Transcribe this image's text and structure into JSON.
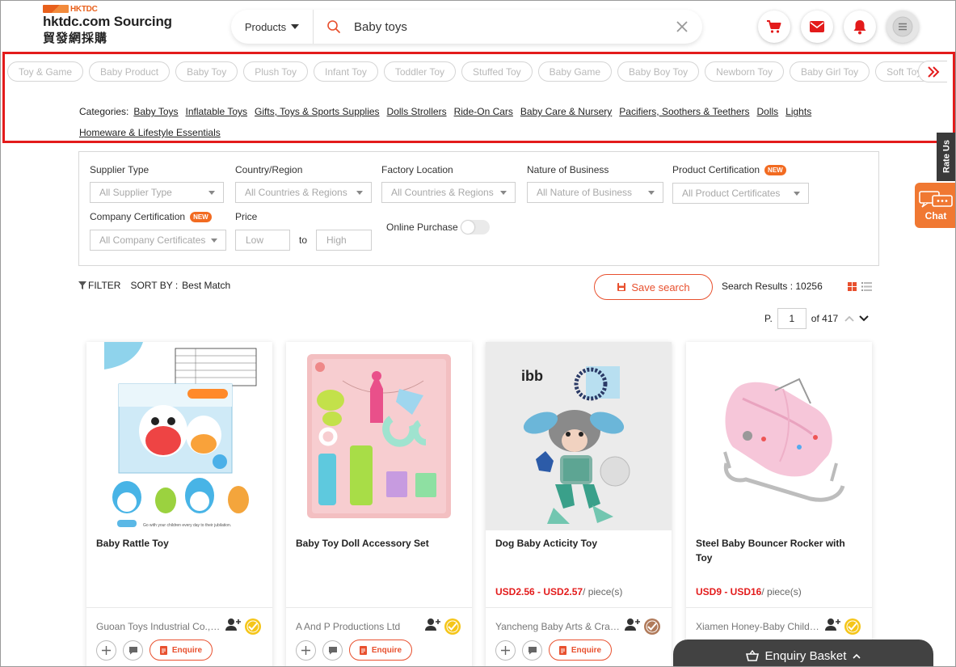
{
  "header": {
    "logo_brand": "HKTDC",
    "logo_title": "hktdc.com Sourcing",
    "logo_subtitle": "貿發網採購",
    "search_category": "Products",
    "search_query": "Baby toys"
  },
  "related_tags": [
    "Toy & Game",
    "Baby Product",
    "Baby Toy",
    "Plush Toy",
    "Infant Toy",
    "Toddler Toy",
    "Stuffed Toy",
    "Baby Game",
    "Baby Boy Toy",
    "Newborn Toy",
    "Baby Girl Toy",
    "Soft Toy"
  ],
  "categories": {
    "label": "Categories:",
    "items": [
      "Baby Toys",
      "Inflatable Toys",
      "Gifts, Toys & Sports Supplies",
      "Dolls Strollers",
      "Ride-On Cars",
      "Baby Care & Nursery",
      "Pacifiers, Soothers & Teethers",
      "Dolls",
      "Lights",
      "Homeware & Lifestyle Essentials"
    ]
  },
  "filters": {
    "supplier_type": {
      "label": "Supplier Type",
      "value": "All Supplier Type"
    },
    "country_region": {
      "label": "Country/Region",
      "value": "All Countries & Regions"
    },
    "factory_location": {
      "label": "Factory Location",
      "value": "All Countries & Regions"
    },
    "nature_of_business": {
      "label": "Nature of Business",
      "value": "All Nature of Business"
    },
    "product_certification": {
      "label": "Product Certification",
      "value": "All Product Certificates",
      "badge": "NEW"
    },
    "company_certification": {
      "label": "Company Certification",
      "value": "All Company Certificates",
      "badge": "NEW"
    },
    "price": {
      "label": "Price",
      "low_placeholder": "Low",
      "high_placeholder": "High",
      "to": "to"
    },
    "online_purchase": {
      "label": "Online Purchase",
      "enabled": false
    }
  },
  "sortbar": {
    "filter_label": "FILTER",
    "sort_label": "SORT BY :",
    "sort_value": "Best Match",
    "save_search": "Save search",
    "results": "Search Results : 10256"
  },
  "pager": {
    "prefix": "P.",
    "current": "1",
    "total": "of 417"
  },
  "products": [
    {
      "name": "Baby Rattle Toy",
      "price": "",
      "unit": "",
      "supplier": "Guoan Toys Industrial Co., Limited",
      "verified_color": "#f5c518",
      "enquire": "Enquire"
    },
    {
      "name": "Baby Toy Doll Accessory Set",
      "price": "",
      "unit": "",
      "supplier": "A And P Productions Ltd",
      "verified_color": "#f5c518",
      "enquire": "Enquire"
    },
    {
      "name": "Dog Baby Acticity Toy",
      "price": "USD2.56 - USD2.57",
      "unit": "/ piece(s)",
      "supplier": "Yancheng Baby Arts & Crafts Co., Ltd.",
      "verified_color": "#b07a5a",
      "enquire": "Enquire"
    },
    {
      "name": "Steel Baby Bouncer Rocker with Toy",
      "price": "USD9 - USD16",
      "unit": "/ piece(s)",
      "supplier": "Xiamen Honey-Baby Children Products Co., Ltd.",
      "verified_color": "#f5c518",
      "enquire": "Enquire"
    }
  ],
  "basket": {
    "label": "Enquiry Basket"
  },
  "side": {
    "rate_us": "Rate Us",
    "chat": "Chat"
  },
  "colors": {
    "accent": "#e8502e",
    "highlight": "#e31b1b"
  }
}
